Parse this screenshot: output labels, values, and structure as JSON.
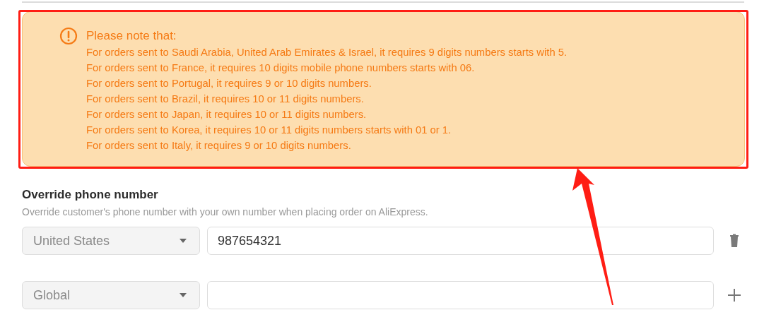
{
  "notice": {
    "title": "Please note that:",
    "lines": [
      "For orders sent to Saudi Arabia, United Arab Emirates & Israel, it requires 9 digits numbers starts with 5.",
      "For orders sent to France, it requires 10 digits mobile phone numbers starts with 06.",
      "For orders sent to Portugal, it requires 9 or 10 digits numbers.",
      "For orders sent to Brazil, it requires 10 or 11 digits numbers.",
      "For orders sent to Japan, it requires 10 or 11 digits numbers.",
      "For orders sent to Korea, it requires 10 or 11 digits numbers starts with 01 or 1.",
      "For orders sent to Italy, it requires 9 or 10 digits numbers."
    ]
  },
  "section": {
    "title": "Override phone number",
    "description": "Override customer's phone number with your own number when placing order on AliExpress."
  },
  "phone_rows": [
    {
      "country": "United States",
      "number": "987654321",
      "kind": "delete"
    },
    {
      "country": "Global",
      "kind": "add"
    }
  ]
}
